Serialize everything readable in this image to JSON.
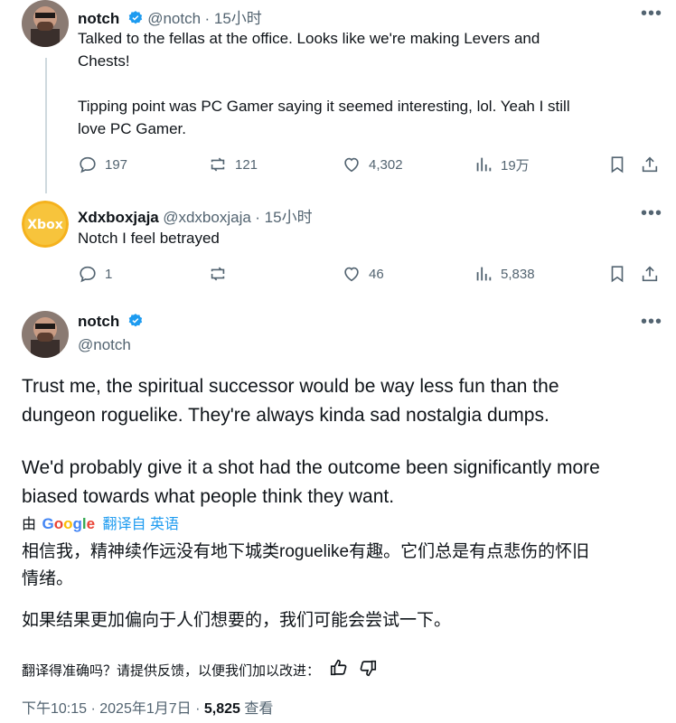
{
  "tweets": [
    {
      "name": "notch",
      "handle": "@notch",
      "time": "15小时",
      "verified": true,
      "lines": [
        "Talked to the fellas at the office.  Looks like we're making Levers and",
        "Chests!",
        "",
        "Tipping point was PC Gamer saying it seemed interesting, lol. Yeah I still",
        "love PC Gamer."
      ],
      "stats": {
        "replies": "197",
        "reposts": "121",
        "likes": "4,302",
        "views": "19万"
      }
    },
    {
      "name": "Xdxboxjaja",
      "handle": "@xdxboxjaja",
      "time": "15小时",
      "avatar_text": "Xbox",
      "lines": [
        "Notch I feel betrayed"
      ],
      "stats": {
        "replies": "1",
        "reposts": "",
        "likes": "46",
        "views": "5,838"
      }
    }
  ],
  "main_tweet": {
    "name": "notch",
    "handle": "@notch",
    "paragraph1_lines": [
      "Trust me, the spiritual successor would be way less fun than the",
      "dungeon roguelike. They're always kinda sad nostalgia dumps."
    ],
    "paragraph2_lines": [
      "We'd probably give it a shot had the outcome been significantly more",
      "biased towards what people think they want."
    ],
    "translated_by": "由",
    "google": "Google",
    "translate_link": "翻译自 英语",
    "translation_p1_lines": [
      "相信我，精神续作远没有地下城类roguelike有趣。它们总是有点悲伤的怀旧",
      "情绪。"
    ],
    "translation_p2_lines": [
      "如果结果更加偏向于人们想要的，我们可能会尝试一下。"
    ],
    "feedback_prompt": "翻译得准确吗？请提供反馈，以便我们加以改进：",
    "timestamp": "下午10:15 · 2025年1月7日 · ",
    "views_count": "5,825",
    "views_label": " 查看"
  },
  "colors": {
    "verified": "#1d9bf0",
    "link": "#1d9bf0",
    "secondary": "#536471",
    "thread_line": "#cfd9de"
  }
}
